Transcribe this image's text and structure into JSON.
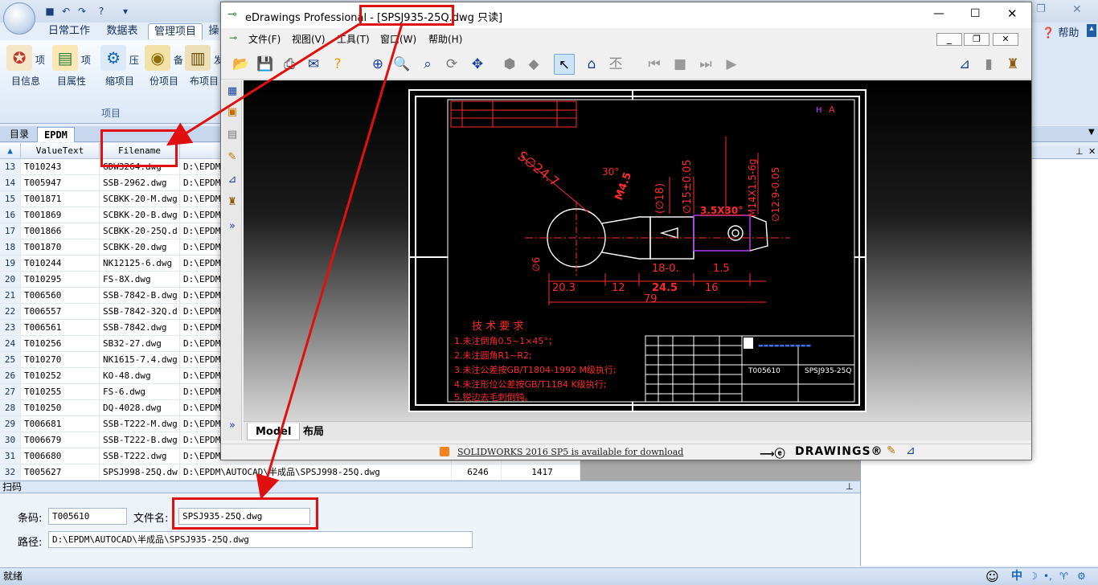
{
  "app": {
    "qat_symbols": [
      "▾"
    ],
    "tabs": [
      "日常工作",
      "数据表",
      "管理项目",
      "操"
    ],
    "ribbon_buttons": [
      "项目信息",
      "项目属性",
      "压缩项目",
      "备份项目",
      "发布项目"
    ],
    "group_caption": "项目",
    "help": "帮助",
    "doc_tabs": [
      "目录",
      "EPDM"
    ],
    "grid": {
      "headers": [
        "ValueText",
        "Filename"
      ],
      "rows": [
        {
          "n": "13",
          "v": "T010243",
          "f": "GDW3264.dwg",
          "p": "D:\\EPDM"
        },
        {
          "n": "14",
          "v": "T005947",
          "f": "SSB-2962.dwg",
          "p": "D:\\EPDM"
        },
        {
          "n": "15",
          "v": "T001871",
          "f": "SCBKK-20-M.dwg",
          "p": "D:\\EPDM"
        },
        {
          "n": "16",
          "v": "T001869",
          "f": "SCBKK-20-B.dwg",
          "p": "D:\\EPDM"
        },
        {
          "n": "17",
          "v": "T001866",
          "f": "SCBKK-20-25Q.d",
          "p": "D:\\EPDM"
        },
        {
          "n": "18",
          "v": "T001870",
          "f": "SCBKK-20.dwg",
          "p": "D:\\EPDM"
        },
        {
          "n": "19",
          "v": "T010244",
          "f": "NK12125-6.dwg",
          "p": "D:\\EPDM"
        },
        {
          "n": "20",
          "v": "T010295",
          "f": "FS-8X.dwg",
          "p": "D:\\EPDM"
        },
        {
          "n": "21",
          "v": "T006560",
          "f": "SSB-7842-B.dwg",
          "p": "D:\\EPDM"
        },
        {
          "n": "22",
          "v": "T006557",
          "f": "SSB-7842-32Q.d",
          "p": "D:\\EPDM"
        },
        {
          "n": "23",
          "v": "T006561",
          "f": "SSB-7842.dwg",
          "p": "D:\\EPDM"
        },
        {
          "n": "24",
          "v": "T010256",
          "f": "SB32-27.dwg",
          "p": "D:\\EPDM"
        },
        {
          "n": "25",
          "v": "T010270",
          "f": "NK1615-7.4.dwg",
          "p": "D:\\EPDM"
        },
        {
          "n": "26",
          "v": "T010252",
          "f": "KO-48.dwg",
          "p": "D:\\EPDM"
        },
        {
          "n": "27",
          "v": "T010255",
          "f": "FS-6.dwg",
          "p": "D:\\EPDM"
        },
        {
          "n": "28",
          "v": "T010250",
          "f": "DQ-4028.dwg",
          "p": "D:\\EPDM"
        },
        {
          "n": "29",
          "v": "T006681",
          "f": "SSB-T222-M.dwg",
          "p": "D:\\EPDM"
        },
        {
          "n": "30",
          "v": "T006679",
          "f": "SSB-T222-B.dwg",
          "p": "D:\\EPDM"
        },
        {
          "n": "31",
          "v": "T006680",
          "f": "SSB-T222.dwg",
          "p": "D:\\EPDM"
        },
        {
          "n": "32",
          "v": "T005627",
          "f": "SPSJ998-25Q.dw",
          "p": "D:\\EPDM\\AUTOCAD\\半成品\\SPSJ998-25Q.dwg",
          "c4": "6246",
          "c5": "1417"
        }
      ]
    },
    "scan": {
      "title": "扫码",
      "barcode_label": "条码:",
      "barcode_value": "T005610",
      "filename_label": "文件名:",
      "filename_value": "SPSJ935-25Q.dwg",
      "path_label": "路径:",
      "path_value": "D:\\EPDM\\AUTOCAD\\半成品\\SPSJ935-25Q.dwg"
    },
    "status": "就绪",
    "tray": "中"
  },
  "edrawings": {
    "title_prefix": "eDrawings Professional - ",
    "title_file": "[SPSJ935-25Q.dwg",
    "title_suffix": " 只读]",
    "menu": [
      "文件(F)",
      "视图(V)",
      "工具(T)",
      "窗口(W)",
      "帮助(H)"
    ],
    "tabs": [
      "Model",
      "布局"
    ],
    "notice": "SOLIDWORKS 2016 SP5 is available for download",
    "brand": "DRAWINGS®",
    "drawing": {
      "dims": [
        "S∅24.7",
        "30°",
        "M4.5",
        "(∅18)",
        "∅15±0.05",
        "M14X1.5-6g",
        "∅12.9-0.05",
        "3.5X30°",
        "∅6",
        "20.3",
        "12",
        "24.5",
        "16",
        "18-0.",
        "1.5",
        "79",
        "H",
        "A"
      ],
      "notes": [
        "技 术 要 求",
        "1.未注倒角0.5~1×45°；",
        "2.未注圆角R1~R2;",
        "3.未注公差按GB/T1804-1992 M级执行;",
        "4.未注形位公差按GB/T1184 K级执行;",
        "5.锐边去毛刺倒钝。"
      ],
      "title_block": [
        "T005610",
        "SPSJ935-25Q"
      ]
    }
  },
  "colors": {
    "accent": "#e01010",
    "cad_red": "#ff2a2a",
    "ribbon": "#dbe7f6"
  }
}
